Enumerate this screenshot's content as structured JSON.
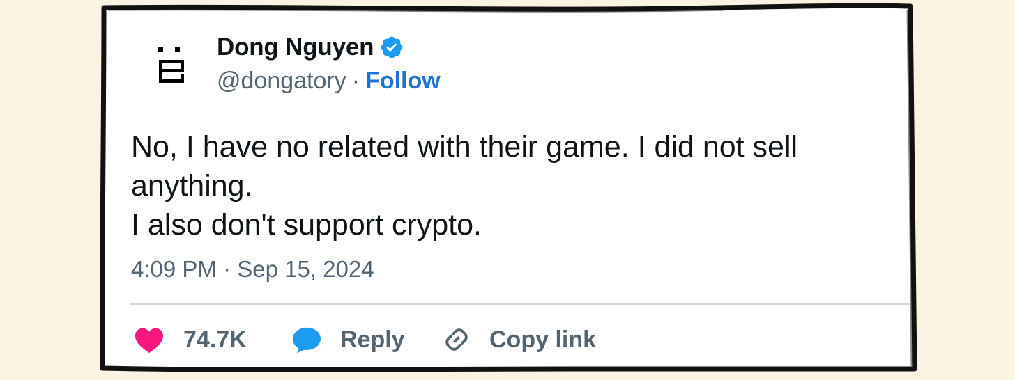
{
  "author": {
    "display_name": "Dong Nguyen",
    "handle": "@dongatory",
    "separator": "·",
    "follow_label": "Follow",
    "verified": true,
    "avatar_icon": "pixel-face-icon"
  },
  "tweet": {
    "text_lines": [
      "No, I have no related with their game. I did not sell",
      "anything.",
      "I also don't support crypto."
    ],
    "timestamp": "4:09 PM · Sep 15, 2024"
  },
  "actions": {
    "likes_count": "74.7K",
    "reply_label": "Reply",
    "copy_link_label": "Copy link"
  },
  "colors": {
    "page_background": "#faf3e2",
    "card_background": "#ffffff",
    "frame_stroke": "#111111",
    "text_primary": "#0f1419",
    "text_secondary": "#536471",
    "follow_link": "#1d72d2",
    "verified_badge": "#1d9bf0",
    "like_heart": "#f91880",
    "reply_bubble": "#1d9bf0",
    "divider": "#cfd9de"
  },
  "icons": [
    "pixel-face-icon",
    "verified-badge-icon",
    "heart-icon",
    "reply-bubble-icon",
    "link-icon"
  ]
}
